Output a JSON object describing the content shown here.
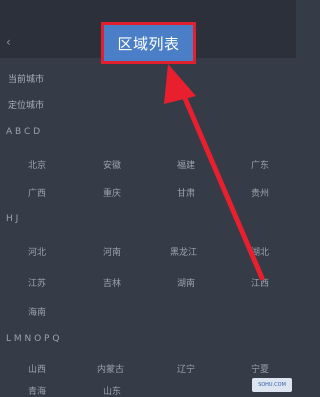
{
  "header": {
    "back_label": "",
    "title": "区域列表"
  },
  "rows": [
    {
      "label": "当前城市"
    },
    {
      "label": "定位城市"
    }
  ],
  "sections": [
    {
      "title": "A B C D"
    },
    {
      "title": "H J"
    },
    {
      "title": "L M N O P Q"
    }
  ],
  "chips": [
    "北京",
    "安徽",
    "福建",
    "广东",
    "广西",
    "重庆",
    "甘肃",
    "贵州",
    "河北",
    "河南",
    "黑龙江",
    "湖北",
    "江苏",
    "吉林",
    "湖南",
    "江西",
    "海南",
    "山西",
    "内蒙古",
    "辽宁",
    "宁夏",
    "青海",
    "山东"
  ],
  "watermark": "SOHU.COM",
  "colors": {
    "accent_blue": "#4a7fc8",
    "highlight_red": "#e21f2f",
    "background": "#353b47"
  }
}
